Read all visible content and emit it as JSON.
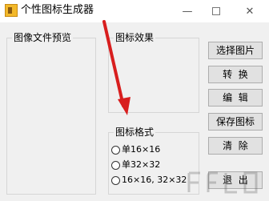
{
  "window": {
    "title": "个性图标生成器",
    "min_glyph": "—",
    "close_glyph": "✕"
  },
  "groups": {
    "preview_title": "图像文件预览",
    "effect_title": "图标效果",
    "format_title": "图标格式"
  },
  "format_options": [
    "单16×16",
    "单32×32",
    "16×16, 32×32"
  ],
  "buttons": {
    "select_image": "选择图片",
    "convert": "转  换",
    "edit": "编  辑",
    "save_icon": "保存图标",
    "clear": "清  除",
    "exit": "退  出"
  },
  "colors": {
    "arrow": "#d81e1e",
    "app_icon": "#f3b92a"
  }
}
